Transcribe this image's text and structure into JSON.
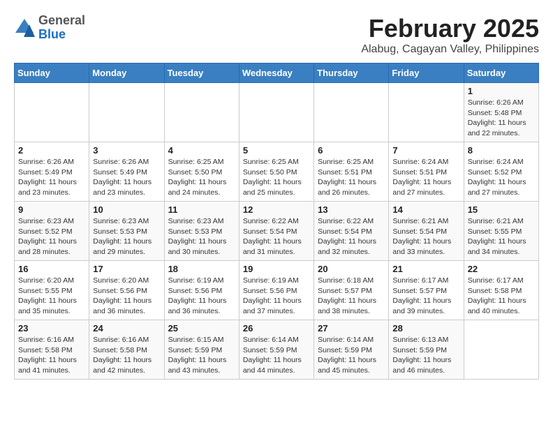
{
  "header": {
    "logo": {
      "general": "General",
      "blue": "Blue"
    },
    "title": "February 2025",
    "subtitle": "Alabug, Cagayan Valley, Philippines"
  },
  "days_of_week": [
    "Sunday",
    "Monday",
    "Tuesday",
    "Wednesday",
    "Thursday",
    "Friday",
    "Saturday"
  ],
  "weeks": [
    [
      {
        "day": "",
        "info": ""
      },
      {
        "day": "",
        "info": ""
      },
      {
        "day": "",
        "info": ""
      },
      {
        "day": "",
        "info": ""
      },
      {
        "day": "",
        "info": ""
      },
      {
        "day": "",
        "info": ""
      },
      {
        "day": "1",
        "info": "Sunrise: 6:26 AM\nSunset: 5:48 PM\nDaylight: 11 hours\nand 22 minutes."
      }
    ],
    [
      {
        "day": "2",
        "info": "Sunrise: 6:26 AM\nSunset: 5:49 PM\nDaylight: 11 hours\nand 23 minutes."
      },
      {
        "day": "3",
        "info": "Sunrise: 6:26 AM\nSunset: 5:49 PM\nDaylight: 11 hours\nand 23 minutes."
      },
      {
        "day": "4",
        "info": "Sunrise: 6:25 AM\nSunset: 5:50 PM\nDaylight: 11 hours\nand 24 minutes."
      },
      {
        "day": "5",
        "info": "Sunrise: 6:25 AM\nSunset: 5:50 PM\nDaylight: 11 hours\nand 25 minutes."
      },
      {
        "day": "6",
        "info": "Sunrise: 6:25 AM\nSunset: 5:51 PM\nDaylight: 11 hours\nand 26 minutes."
      },
      {
        "day": "7",
        "info": "Sunrise: 6:24 AM\nSunset: 5:51 PM\nDaylight: 11 hours\nand 27 minutes."
      },
      {
        "day": "8",
        "info": "Sunrise: 6:24 AM\nSunset: 5:52 PM\nDaylight: 11 hours\nand 27 minutes."
      }
    ],
    [
      {
        "day": "9",
        "info": "Sunrise: 6:23 AM\nSunset: 5:52 PM\nDaylight: 11 hours\nand 28 minutes."
      },
      {
        "day": "10",
        "info": "Sunrise: 6:23 AM\nSunset: 5:53 PM\nDaylight: 11 hours\nand 29 minutes."
      },
      {
        "day": "11",
        "info": "Sunrise: 6:23 AM\nSunset: 5:53 PM\nDaylight: 11 hours\nand 30 minutes."
      },
      {
        "day": "12",
        "info": "Sunrise: 6:22 AM\nSunset: 5:54 PM\nDaylight: 11 hours\nand 31 minutes."
      },
      {
        "day": "13",
        "info": "Sunrise: 6:22 AM\nSunset: 5:54 PM\nDaylight: 11 hours\nand 32 minutes."
      },
      {
        "day": "14",
        "info": "Sunrise: 6:21 AM\nSunset: 5:54 PM\nDaylight: 11 hours\nand 33 minutes."
      },
      {
        "day": "15",
        "info": "Sunrise: 6:21 AM\nSunset: 5:55 PM\nDaylight: 11 hours\nand 34 minutes."
      }
    ],
    [
      {
        "day": "16",
        "info": "Sunrise: 6:20 AM\nSunset: 5:55 PM\nDaylight: 11 hours\nand 35 minutes."
      },
      {
        "day": "17",
        "info": "Sunrise: 6:20 AM\nSunset: 5:56 PM\nDaylight: 11 hours\nand 36 minutes."
      },
      {
        "day": "18",
        "info": "Sunrise: 6:19 AM\nSunset: 5:56 PM\nDaylight: 11 hours\nand 36 minutes."
      },
      {
        "day": "19",
        "info": "Sunrise: 6:19 AM\nSunset: 5:56 PM\nDaylight: 11 hours\nand 37 minutes."
      },
      {
        "day": "20",
        "info": "Sunrise: 6:18 AM\nSunset: 5:57 PM\nDaylight: 11 hours\nand 38 minutes."
      },
      {
        "day": "21",
        "info": "Sunrise: 6:17 AM\nSunset: 5:57 PM\nDaylight: 11 hours\nand 39 minutes."
      },
      {
        "day": "22",
        "info": "Sunrise: 6:17 AM\nSunset: 5:58 PM\nDaylight: 11 hours\nand 40 minutes."
      }
    ],
    [
      {
        "day": "23",
        "info": "Sunrise: 6:16 AM\nSunset: 5:58 PM\nDaylight: 11 hours\nand 41 minutes."
      },
      {
        "day": "24",
        "info": "Sunrise: 6:16 AM\nSunset: 5:58 PM\nDaylight: 11 hours\nand 42 minutes."
      },
      {
        "day": "25",
        "info": "Sunrise: 6:15 AM\nSunset: 5:59 PM\nDaylight: 11 hours\nand 43 minutes."
      },
      {
        "day": "26",
        "info": "Sunrise: 6:14 AM\nSunset: 5:59 PM\nDaylight: 11 hours\nand 44 minutes."
      },
      {
        "day": "27",
        "info": "Sunrise: 6:14 AM\nSunset: 5:59 PM\nDaylight: 11 hours\nand 45 minutes."
      },
      {
        "day": "28",
        "info": "Sunrise: 6:13 AM\nSunset: 5:59 PM\nDaylight: 11 hours\nand 46 minutes."
      },
      {
        "day": "",
        "info": ""
      }
    ]
  ]
}
